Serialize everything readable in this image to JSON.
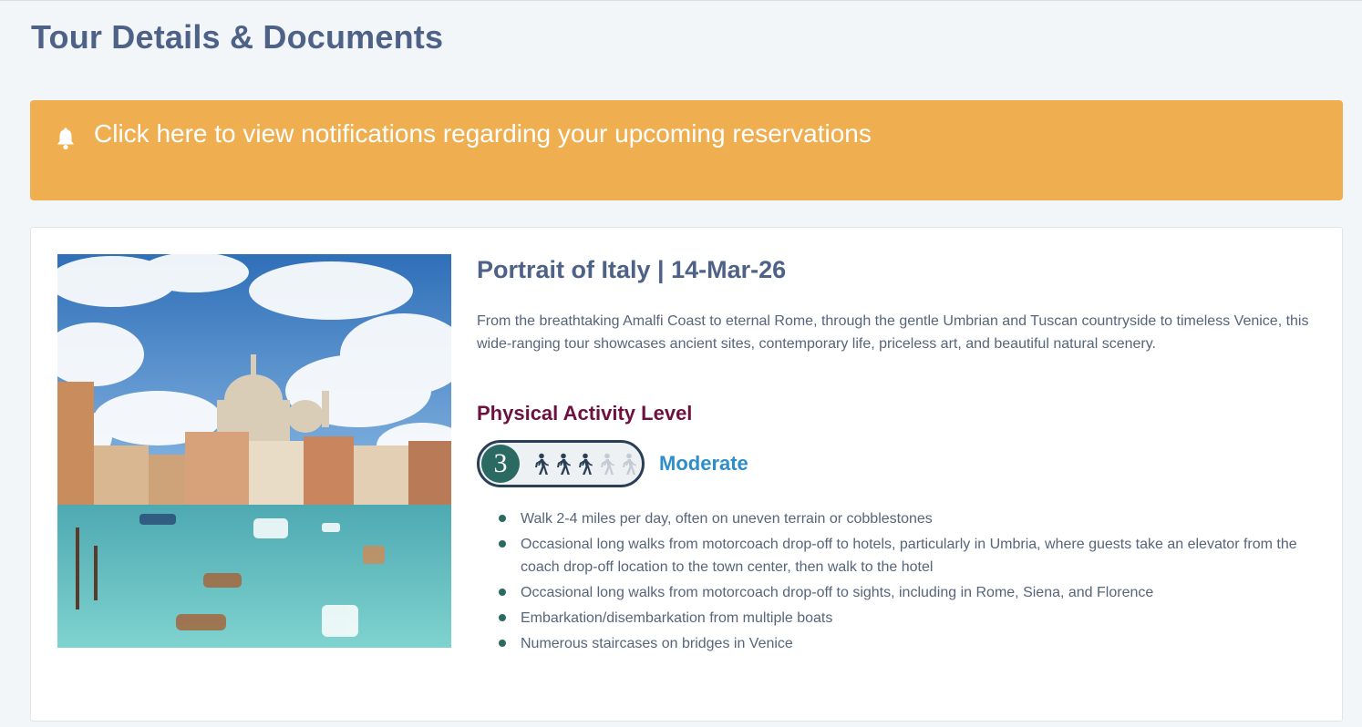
{
  "page": {
    "title": "Tour Details & Documents"
  },
  "notification": {
    "icon": "bell-icon",
    "text": "Click here to view notifications regarding your upcoming reservations",
    "background": "#efaf51"
  },
  "tour": {
    "image_alt": "venice-grand-canal-photo",
    "title": "Portrait of Italy | 14-Mar-26",
    "description": "From the breathtaking Amalfi Coast to eternal Rome, through the gentle Umbrian and Tuscan countryside to timeless Venice, this wide-ranging tour showcases ancient sites, contemporary life, priceless art, and beautiful natural scenery.",
    "activity": {
      "heading": "Physical Activity Level",
      "level": "3",
      "level_max": 5,
      "label": "Moderate",
      "icon": "walking-person-icon",
      "notes": [
        "Walk 2-4 miles per day, often on uneven terrain or cobblestones",
        "Occasional long walks from motorcoach drop-off to hotels, particularly in Umbria, where guests take an elevator from the coach drop-off location to the town center, then walk to the hotel",
        "Occasional long walks from motorcoach drop-off to sights, including in Rome, Siena, and Florence",
        "Embarkation/disembarkation from multiple boats",
        "Numerous staircases on bridges in Venice"
      ]
    }
  },
  "colors": {
    "title": "#4e6186",
    "activity_heading": "#6d1140",
    "level_label": "#2e8ec9",
    "level_circle": "#2b6a63",
    "bullet": "#2b6a63"
  }
}
